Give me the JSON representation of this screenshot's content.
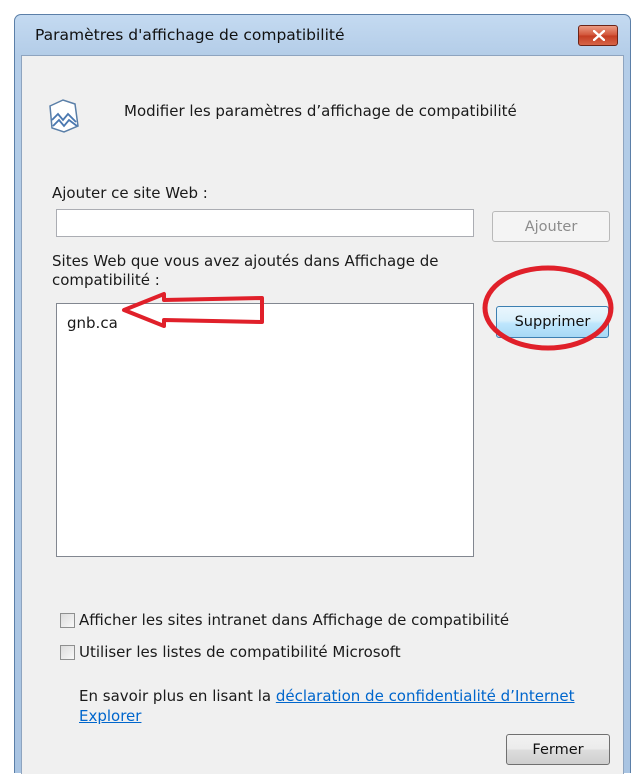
{
  "window": {
    "title": "Paramètres d'affichage de compatibilité"
  },
  "header": {
    "text": "Modifier les paramètres d’affichage de compatibilité"
  },
  "add_site": {
    "label": "Ajouter ce site Web :",
    "value": "",
    "button": "Ajouter"
  },
  "sites": {
    "label": "Sites Web que vous avez ajoutés dans Affichage de compatibilité :",
    "items": [
      "gnb.ca"
    ],
    "remove_button": "Supprimer"
  },
  "options": {
    "intranet": {
      "label": "Afficher les sites intranet dans Affichage de compatibilité",
      "checked": false
    },
    "microsoft_lists": {
      "label": "Utiliser les listes de compatibilité Microsoft",
      "checked": false
    }
  },
  "info": {
    "prefix": "En savoir plus en lisant la ",
    "link": "déclaration de confidentialité d’Internet Explorer"
  },
  "footer": {
    "close_button": "Fermer"
  },
  "annotation_colors": {
    "highlight": "#e0202a"
  }
}
